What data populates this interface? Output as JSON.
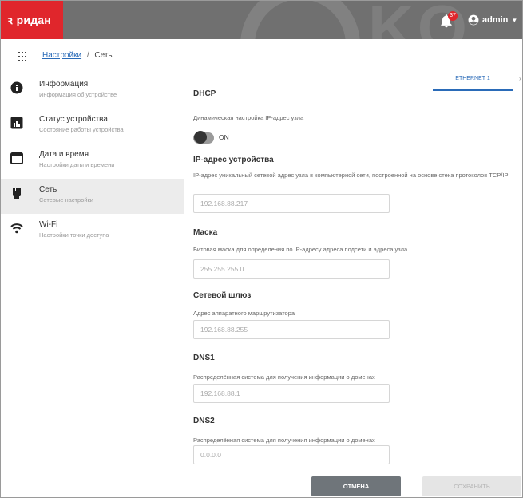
{
  "brand": {
    "name": "ридан",
    "accent_color": "#e0262c",
    "topbar_color": "#707070"
  },
  "header": {
    "notification_count": "37",
    "user_name": "admin",
    "icons": {
      "notifications": "bell-icon",
      "user": "account-circle-icon",
      "menu": "caret-down-icon"
    }
  },
  "breadcrumb": {
    "parent": "Настройки",
    "separator": "/",
    "current": "Сеть",
    "apps_icon": "apps-grid-icon"
  },
  "sidebar": {
    "items": [
      {
        "title": "Информация",
        "subtitle": "Информация об устройстве",
        "icon": "info-icon",
        "active": false
      },
      {
        "title": "Статус устройства",
        "subtitle": "Состояние работы устройства",
        "icon": "chart-icon",
        "active": false
      },
      {
        "title": "Дата и время",
        "subtitle": "Настройки даты и времени",
        "icon": "calendar-icon",
        "active": false
      },
      {
        "title": "Сеть",
        "subtitle": "Сетевые настройки",
        "icon": "ethernet-icon",
        "active": true
      },
      {
        "title": "Wi-Fi",
        "subtitle": "Настройки точки доступа",
        "icon": "wifi-icon",
        "active": false
      }
    ]
  },
  "tabs": {
    "active": "ETHERNET 1"
  },
  "form": {
    "dhcp": {
      "title": "DHCP",
      "description": "Динамическая настройка IP-адрес узла",
      "toggle_label": "ON"
    },
    "ip": {
      "title": "IP-адрес устройства",
      "description": "IP-адрес уникальный сетевой адрес узла в компьютерной сети, построенной на основе стека протоколов TCP/IP",
      "placeholder": "192.168.88.217"
    },
    "mask": {
      "title": "Маска",
      "description": "Битовая маска для определения по IP-адресу адреса подсети и адреса узла",
      "placeholder": "255.255.255.0"
    },
    "gateway": {
      "title": "Сетевой шлюз",
      "description": "Адрес аппаратного маршрутизатора",
      "placeholder": "192.168.88.255"
    },
    "dns1": {
      "title": "DNS1",
      "description": "Распределённая система для получения информации о доменах",
      "placeholder": "192.168.88.1"
    },
    "dns2": {
      "title": "DNS2",
      "description": "Распределённая система для получения информации о доменах",
      "placeholder": "0.0.0.0"
    }
  },
  "buttons": {
    "cancel": "ОТМЕНА",
    "save": "СОХРАНИТЬ"
  }
}
